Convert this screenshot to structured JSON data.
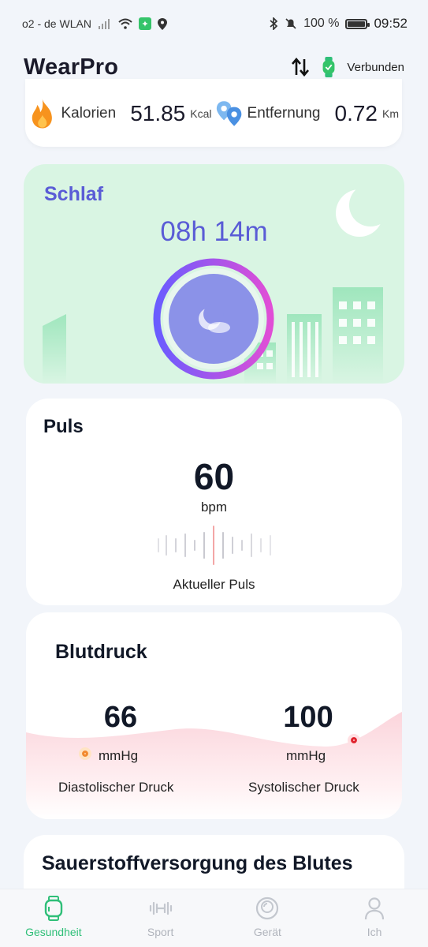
{
  "status_bar": {
    "carrier": "o2 - de WLAN",
    "battery_percent": "100 %",
    "time": "09:52"
  },
  "header": {
    "title": "WearPro",
    "connection_status": "Verbunden"
  },
  "activity": {
    "calories_label": "Kalorien",
    "calories_value": "51.85",
    "calories_unit": "Kcal",
    "distance_label": "Entfernung",
    "distance_value": "0.72",
    "distance_unit": "Km"
  },
  "sleep": {
    "title": "Schlaf",
    "duration": "08h 14m"
  },
  "pulse": {
    "title": "Puls",
    "value": "60",
    "unit": "bpm",
    "caption": "Aktueller Puls"
  },
  "blood_pressure": {
    "title": "Blutdruck",
    "diastolic_value": "66",
    "diastolic_unit": "mmHg",
    "diastolic_label": "Diastolischer Druck",
    "systolic_value": "100",
    "systolic_unit": "mmHg",
    "systolic_label": "Systolischer Druck"
  },
  "oxygen": {
    "title": "Sauerstoffversorgung des Blutes"
  },
  "bottom_nav": {
    "items": [
      {
        "label": "Gesundheit",
        "icon": "watch-icon",
        "active": true
      },
      {
        "label": "Sport",
        "icon": "dumbbell-icon",
        "active": false
      },
      {
        "label": "Gerät",
        "icon": "device-icon",
        "active": false
      },
      {
        "label": "Ich",
        "icon": "person-icon",
        "active": false
      }
    ]
  },
  "colors": {
    "accent_green": "#2fbf78",
    "sleep_purple": "#5a5cd6",
    "sleep_bg": "#d9f5e3"
  }
}
